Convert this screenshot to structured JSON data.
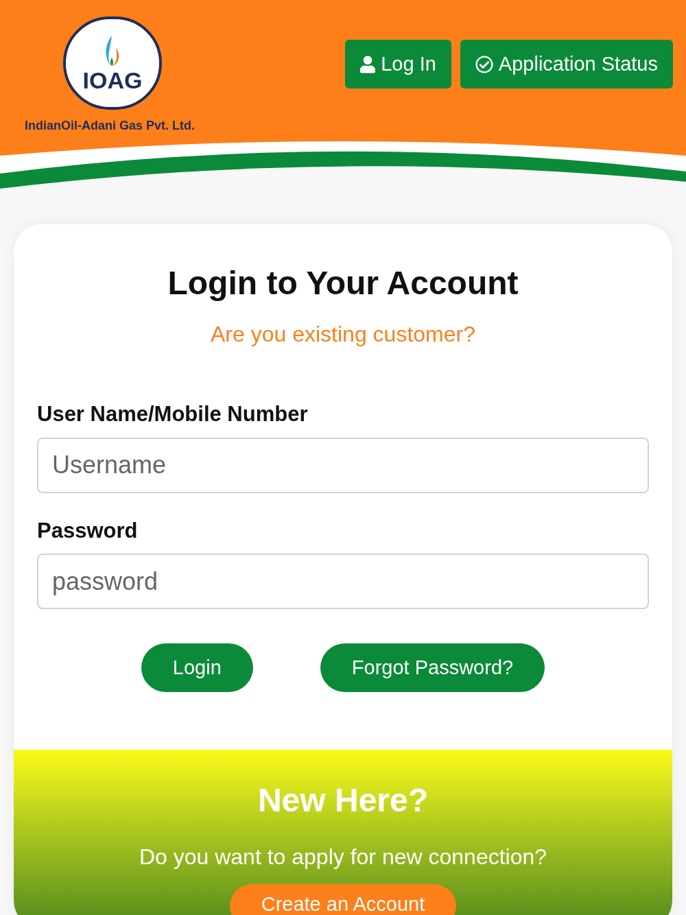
{
  "header": {
    "logo_text": "IOAG",
    "company_name": "IndianOil-Adani Gas Pvt. Ltd.",
    "buttons": [
      {
        "label": "Log In",
        "kind": "user"
      },
      {
        "label": "Application Status",
        "kind": "check"
      }
    ]
  },
  "login": {
    "title": "Login to Your Account",
    "subtitle": "Are you existing customer?",
    "fields": [
      {
        "label": "User Name/Mobile Number",
        "placeholder": "Username"
      },
      {
        "label": "Password",
        "placeholder": "password"
      }
    ],
    "buttons": [
      "Login",
      "Forgot Password?"
    ]
  },
  "signup": {
    "title": "New Here?",
    "text": "Do you want to apply for new connection?",
    "button": "Create an Account"
  }
}
